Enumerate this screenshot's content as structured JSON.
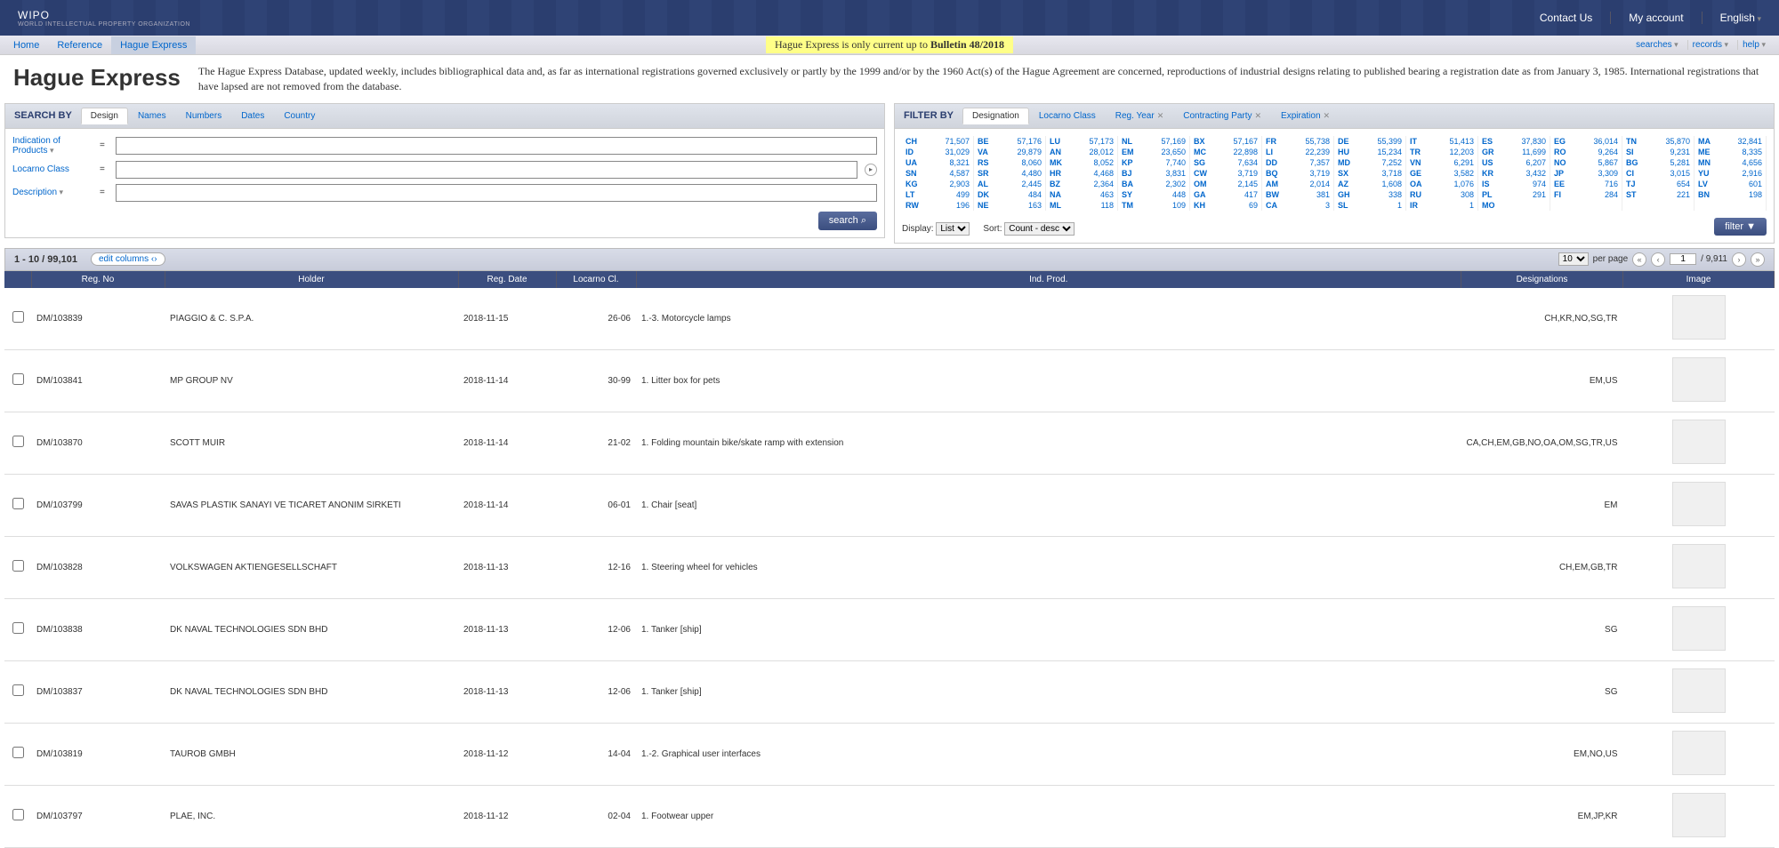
{
  "header": {
    "logo": "WIPO",
    "logo_sub": "WORLD INTELLECTUAL PROPERTY ORGANIZATION",
    "links": [
      "Contact Us",
      "My account",
      "English"
    ]
  },
  "subnav": {
    "items": [
      "Home",
      "Reference",
      "Hague Express"
    ],
    "banner_prefix": "Hague Express is only current up to ",
    "banner_bold": "Bulletin 48/2018",
    "tools": [
      "searches",
      "records",
      "help"
    ]
  },
  "title": "Hague Express",
  "description": "The Hague Express Database, updated weekly, includes bibliographical data and, as far as international registrations governed exclusively or partly by the 1999 and/or by the 1960 Act(s) of the Hague Agreement are concerned, reproductions of industrial designs relating to published bearing a registration date as from January 3, 1985. International registrations that have lapsed are not removed from the database.",
  "search": {
    "header": "SEARCH BY",
    "tabs": [
      "Design",
      "Names",
      "Numbers",
      "Dates",
      "Country"
    ],
    "fields": [
      {
        "label": "Indication of Products",
        "value": ""
      },
      {
        "label": "Locarno Class",
        "value": ""
      },
      {
        "label": "Description",
        "value": ""
      }
    ],
    "button": "search"
  },
  "filter": {
    "header": "FILTER BY",
    "tabs": [
      {
        "label": "Designation",
        "close": false
      },
      {
        "label": "Locarno Class",
        "close": false
      },
      {
        "label": "Reg. Year",
        "close": true
      },
      {
        "label": "Contracting Party",
        "close": true
      },
      {
        "label": "Expiration",
        "close": true
      }
    ],
    "display_label": "Display:",
    "display_value": "List",
    "sort_label": "Sort:",
    "sort_value": "Count - desc",
    "button": "filter",
    "grid": [
      [
        {
          "c": "CH",
          "n": "71,507"
        },
        {
          "c": "BE",
          "n": "57,176"
        },
        {
          "c": "LU",
          "n": "57,173"
        },
        {
          "c": "NL",
          "n": "57,169"
        },
        {
          "c": "BX",
          "n": "57,167"
        },
        {
          "c": "FR",
          "n": "55,738"
        },
        {
          "c": "DE",
          "n": "55,399"
        },
        {
          "c": "IT",
          "n": "51,413"
        },
        {
          "c": "ES",
          "n": "37,830"
        },
        {
          "c": "EG",
          "n": "36,014"
        },
        {
          "c": "TN",
          "n": "35,870"
        },
        {
          "c": "MA",
          "n": "32,841"
        }
      ],
      [
        {
          "c": "ID",
          "n": "31,029"
        },
        {
          "c": "VA",
          "n": "29,879"
        },
        {
          "c": "AN",
          "n": "28,012"
        },
        {
          "c": "EM",
          "n": "23,650"
        },
        {
          "c": "MC",
          "n": "22,898"
        },
        {
          "c": "LI",
          "n": "22,239"
        },
        {
          "c": "HU",
          "n": "15,234"
        },
        {
          "c": "TR",
          "n": "12,203"
        },
        {
          "c": "GR",
          "n": "11,699"
        },
        {
          "c": "RO",
          "n": "9,264"
        },
        {
          "c": "SI",
          "n": "9,231"
        },
        {
          "c": "ME",
          "n": "8,335"
        }
      ],
      [
        {
          "c": "UA",
          "n": "8,321"
        },
        {
          "c": "RS",
          "n": "8,060"
        },
        {
          "c": "MK",
          "n": "8,052"
        },
        {
          "c": "KP",
          "n": "7,740"
        },
        {
          "c": "SG",
          "n": "7,634"
        },
        {
          "c": "DD",
          "n": "7,357"
        },
        {
          "c": "MD",
          "n": "7,252"
        },
        {
          "c": "VN",
          "n": "6,291"
        },
        {
          "c": "US",
          "n": "6,207"
        },
        {
          "c": "NO",
          "n": "5,867"
        },
        {
          "c": "BG",
          "n": "5,281"
        },
        {
          "c": "MN",
          "n": "4,656"
        }
      ],
      [
        {
          "c": "SN",
          "n": "4,587"
        },
        {
          "c": "SR",
          "n": "4,480"
        },
        {
          "c": "HR",
          "n": "4,468"
        },
        {
          "c": "BJ",
          "n": "3,831"
        },
        {
          "c": "CW",
          "n": "3,719"
        },
        {
          "c": "BQ",
          "n": "3,719"
        },
        {
          "c": "SX",
          "n": "3,718"
        },
        {
          "c": "GE",
          "n": "3,582"
        },
        {
          "c": "KR",
          "n": "3,432"
        },
        {
          "c": "JP",
          "n": "3,309"
        },
        {
          "c": "CI",
          "n": "3,015"
        },
        {
          "c": "YU",
          "n": "2,916"
        }
      ],
      [
        {
          "c": "KG",
          "n": "2,903"
        },
        {
          "c": "AL",
          "n": "2,445"
        },
        {
          "c": "BZ",
          "n": "2,364"
        },
        {
          "c": "BA",
          "n": "2,302"
        },
        {
          "c": "OM",
          "n": "2,145"
        },
        {
          "c": "AM",
          "n": "2,014"
        },
        {
          "c": "AZ",
          "n": "1,608"
        },
        {
          "c": "OA",
          "n": "1,076"
        },
        {
          "c": "IS",
          "n": "974"
        },
        {
          "c": "EE",
          "n": "716"
        },
        {
          "c": "TJ",
          "n": "654"
        },
        {
          "c": "LV",
          "n": "601"
        }
      ],
      [
        {
          "c": "LT",
          "n": "499"
        },
        {
          "c": "DK",
          "n": "484"
        },
        {
          "c": "NA",
          "n": "463"
        },
        {
          "c": "SY",
          "n": "448"
        },
        {
          "c": "GA",
          "n": "417"
        },
        {
          "c": "BW",
          "n": "381"
        },
        {
          "c": "GH",
          "n": "338"
        },
        {
          "c": "RU",
          "n": "308"
        },
        {
          "c": "PL",
          "n": "291"
        },
        {
          "c": "FI",
          "n": "284"
        },
        {
          "c": "ST",
          "n": "221"
        },
        {
          "c": "BN",
          "n": "198"
        }
      ],
      [
        {
          "c": "RW",
          "n": "196"
        },
        {
          "c": "NE",
          "n": "163"
        },
        {
          "c": "ML",
          "n": "118"
        },
        {
          "c": "TM",
          "n": "109"
        },
        {
          "c": "KH",
          "n": "69"
        },
        {
          "c": "CA",
          "n": "3"
        },
        {
          "c": "SL",
          "n": "1"
        },
        {
          "c": "IR",
          "n": "1"
        },
        {
          "c": "MO",
          "n": ""
        },
        {
          "c": "",
          "n": ""
        },
        {
          "c": "",
          "n": ""
        },
        {
          "c": "",
          "n": ""
        }
      ]
    ]
  },
  "results_bar": {
    "range": "1 - 10 / 99,101",
    "edit_columns": "edit columns",
    "per_page_value": "10",
    "per_page_label": "per page",
    "page_value": "1",
    "page_total": "/ 9,911"
  },
  "columns": [
    "",
    "Reg. No",
    "Holder",
    "Reg. Date",
    "Locarno Cl.",
    "Ind. Prod.",
    "Designations",
    "Image"
  ],
  "rows": [
    {
      "regno": "DM/103839",
      "holder": "PIAGGIO & C. S.P.A.",
      "date": "2018-11-15",
      "locarno": "26-06",
      "indprod": "1.-3. Motorcycle lamps",
      "desig": "CH,KR,NO,SG,TR"
    },
    {
      "regno": "DM/103841",
      "holder": "MP GROUP NV",
      "date": "2018-11-14",
      "locarno": "30-99",
      "indprod": "1. Litter box for pets",
      "desig": "EM,US"
    },
    {
      "regno": "DM/103870",
      "holder": "SCOTT MUIR",
      "date": "2018-11-14",
      "locarno": "21-02",
      "indprod": "1. Folding mountain bike/skate ramp with extension",
      "desig": "CA,CH,EM,GB,NO,OA,OM,SG,TR,US"
    },
    {
      "regno": "DM/103799",
      "holder": "SAVAS PLASTIK SANAYI VE TICARET ANONIM SIRKETI",
      "date": "2018-11-14",
      "locarno": "06-01",
      "indprod": "1. Chair [seat]",
      "desig": "EM"
    },
    {
      "regno": "DM/103828",
      "holder": "VOLKSWAGEN AKTIENGESELLSCHAFT",
      "date": "2018-11-13",
      "locarno": "12-16",
      "indprod": "1. Steering wheel for vehicles",
      "desig": "CH,EM,GB,TR"
    },
    {
      "regno": "DM/103838",
      "holder": "DK NAVAL TECHNOLOGIES SDN BHD",
      "date": "2018-11-13",
      "locarno": "12-06",
      "indprod": "1. Tanker [ship]",
      "desig": "SG"
    },
    {
      "regno": "DM/103837",
      "holder": "DK NAVAL TECHNOLOGIES SDN BHD",
      "date": "2018-11-13",
      "locarno": "12-06",
      "indprod": "1. Tanker [ship]",
      "desig": "SG"
    },
    {
      "regno": "DM/103819",
      "holder": "TAUROB GMBH",
      "date": "2018-11-12",
      "locarno": "14-04",
      "indprod": "1.-2. Graphical user interfaces",
      "desig": "EM,NO,US"
    },
    {
      "regno": "DM/103797",
      "holder": "PLAE, INC.",
      "date": "2018-11-12",
      "locarno": "02-04",
      "indprod": "1. Footwear upper",
      "desig": "EM,JP,KR"
    }
  ]
}
